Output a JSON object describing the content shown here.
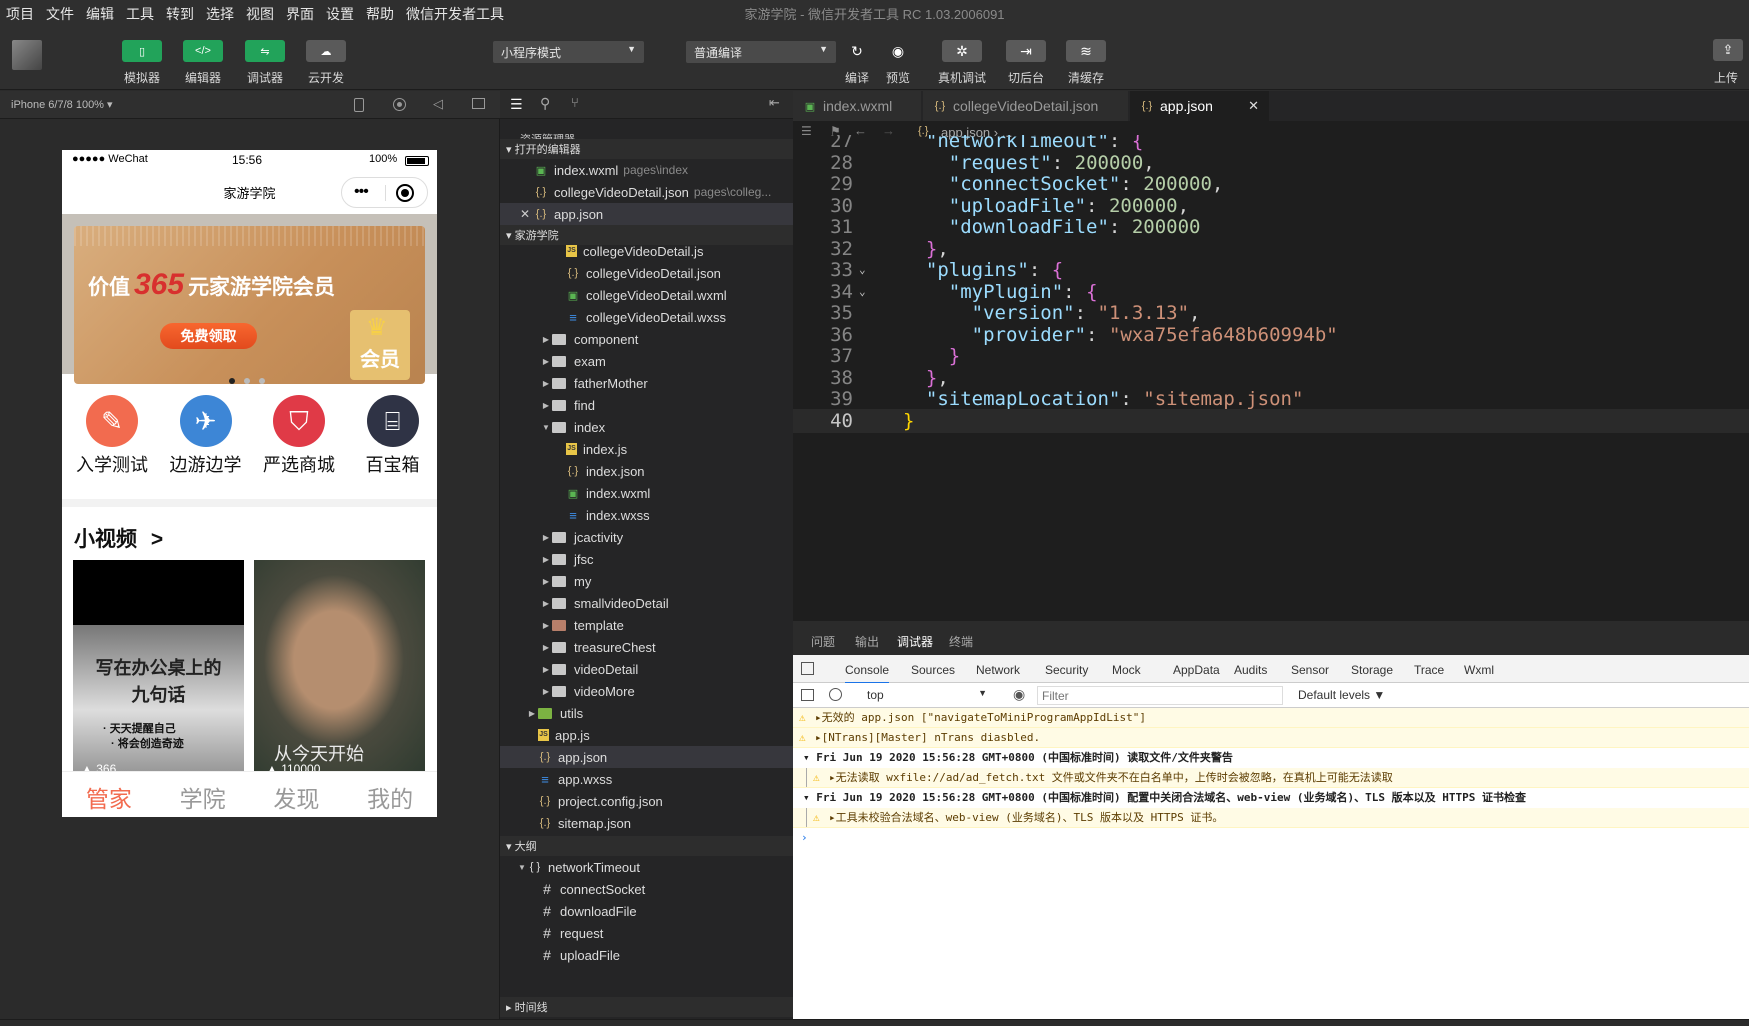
{
  "menubar": {
    "items": [
      "项目",
      "文件",
      "编辑",
      "工具",
      "转到",
      "选择",
      "视图",
      "界面",
      "设置",
      "帮助",
      "微信开发者工具"
    ],
    "window_title": "家游学院 - 微信开发者工具 RC 1.03.2006091"
  },
  "toolbar": {
    "left_buttons": [
      {
        "label": "模拟器",
        "icon": "phone-icon"
      },
      {
        "label": "编辑器",
        "icon": "code-icon"
      },
      {
        "label": "调试器",
        "icon": "debug-icon"
      },
      {
        "label": "云开发",
        "icon": "cloud-icon"
      }
    ],
    "mode_select": "小程序模式",
    "compile_select": "普通编译",
    "right_buttons": [
      {
        "label": "编译",
        "icon": "refresh-icon"
      },
      {
        "label": "预览",
        "icon": "eye-icon"
      },
      {
        "label": "真机调试",
        "icon": "bug-icon"
      },
      {
        "label": "切后台",
        "icon": "switch-icon"
      },
      {
        "label": "清缓存",
        "icon": "layers-icon"
      }
    ],
    "upload_label": "上传"
  },
  "simulator": {
    "device_label": "iPhone 6/7/8 100% ▾",
    "status": {
      "carrier": "●●●●● WeChat",
      "time": "15:56",
      "battery": "100%"
    },
    "nav_title": "家游学院",
    "banner": {
      "text_prefix": "价值",
      "number": "365",
      "text_suffix": "元家游学院会员",
      "button": "免费领取",
      "badge": "会员"
    },
    "categories": [
      {
        "label": "入学测试",
        "icon": "pencil-icon",
        "color": "#f26b4f"
      },
      {
        "label": "边游边学",
        "icon": "plane-icon",
        "color": "#3d86d6"
      },
      {
        "label": "严选商城",
        "icon": "bag-icon",
        "color": "#e03a47"
      },
      {
        "label": "百宝箱",
        "icon": "gift-icon",
        "color": "#2f3345"
      }
    ],
    "section_title": "小视频",
    "section_more": ">",
    "videos": [
      {
        "text1": "写在办公桌上的",
        "text2": "九句话",
        "sub1": "· 天天提醒自己",
        "sub2": "· 将会创造奇迹",
        "count": "366"
      },
      {
        "overlay": "从今天开始",
        "count": "110000"
      }
    ],
    "tabbar": [
      {
        "label": "管家",
        "active": true
      },
      {
        "label": "学院",
        "active": false
      },
      {
        "label": "发现",
        "active": false
      },
      {
        "label": "我的",
        "active": false
      }
    ]
  },
  "explorer": {
    "title": "资源管理器",
    "open_editors_header": "打开的编辑器",
    "open_editors": [
      {
        "name": "index.wxml",
        "path": "pages\\index",
        "type": "wxml"
      },
      {
        "name": "collegeVideoDetail.json",
        "path": "pages\\colleg...",
        "type": "json"
      },
      {
        "name": "app.json",
        "path": "",
        "type": "json",
        "closing": true
      }
    ],
    "project_header": "家游学院",
    "tree": [
      {
        "name": "collegeVideoDetail.js",
        "type": "js",
        "depth": 3
      },
      {
        "name": "collegeVideoDetail.json",
        "type": "json",
        "depth": 3
      },
      {
        "name": "collegeVideoDetail.wxml",
        "type": "wxml",
        "depth": 3
      },
      {
        "name": "collegeVideoDetail.wxss",
        "type": "wxss",
        "depth": 3
      },
      {
        "name": "component",
        "type": "folder",
        "depth": 2
      },
      {
        "name": "exam",
        "type": "folder",
        "depth": 2
      },
      {
        "name": "fatherMother",
        "type": "folder",
        "depth": 2
      },
      {
        "name": "find",
        "type": "folder",
        "depth": 2
      },
      {
        "name": "index",
        "type": "folder-open",
        "depth": 2
      },
      {
        "name": "index.js",
        "type": "js",
        "depth": 3
      },
      {
        "name": "index.json",
        "type": "json",
        "depth": 3
      },
      {
        "name": "index.wxml",
        "type": "wxml",
        "depth": 3
      },
      {
        "name": "index.wxss",
        "type": "wxss",
        "depth": 3
      },
      {
        "name": "jcactivity",
        "type": "folder",
        "depth": 2
      },
      {
        "name": "jfsc",
        "type": "folder",
        "depth": 2
      },
      {
        "name": "my",
        "type": "folder",
        "depth": 2
      },
      {
        "name": "smallvideoDetail",
        "type": "folder",
        "depth": 2
      },
      {
        "name": "template",
        "type": "folder-special",
        "depth": 2
      },
      {
        "name": "treasureChest",
        "type": "folder",
        "depth": 2
      },
      {
        "name": "videoDetail",
        "type": "folder",
        "depth": 2
      },
      {
        "name": "videoMore",
        "type": "folder",
        "depth": 2
      },
      {
        "name": "utils",
        "type": "folder-green",
        "depth": 1
      },
      {
        "name": "app.js",
        "type": "js",
        "depth": 1
      },
      {
        "name": "app.json",
        "type": "json",
        "depth": 1,
        "selected": true
      },
      {
        "name": "app.wxss",
        "type": "wxss",
        "depth": 1
      },
      {
        "name": "project.config.json",
        "type": "json",
        "depth": 1
      },
      {
        "name": "sitemap.json",
        "type": "json",
        "depth": 1
      }
    ],
    "outline_header": "大纲",
    "outline": [
      {
        "name": "networkTimeout",
        "type": "object",
        "depth": 1
      },
      {
        "name": "connectSocket",
        "type": "hash",
        "depth": 2
      },
      {
        "name": "downloadFile",
        "type": "hash",
        "depth": 2
      },
      {
        "name": "request",
        "type": "hash",
        "depth": 2
      },
      {
        "name": "uploadFile",
        "type": "hash",
        "depth": 2
      }
    ],
    "timeline_header": "时间线"
  },
  "editor": {
    "tabs": [
      {
        "name": "index.wxml",
        "type": "wxml"
      },
      {
        "name": "collegeVideoDetail.json",
        "type": "json"
      },
      {
        "name": "app.json",
        "type": "json",
        "active": true
      }
    ],
    "breadcrumb": "app.json › ...",
    "lines": [
      {
        "n": "27",
        "t": "  \"networkTimeout\": {"
      },
      {
        "n": "28",
        "t": "    \"request\": 200000,"
      },
      {
        "n": "29",
        "t": "    \"connectSocket\": 200000,"
      },
      {
        "n": "30",
        "t": "    \"uploadFile\": 200000,"
      },
      {
        "n": "31",
        "t": "    \"downloadFile\": 200000"
      },
      {
        "n": "32",
        "t": "  },"
      },
      {
        "n": "33",
        "t": "  \"plugins\": {"
      },
      {
        "n": "34",
        "t": "    \"myPlugin\": {"
      },
      {
        "n": "35",
        "t": "      \"version\": \"1.3.13\","
      },
      {
        "n": "36",
        "t": "      \"provider\": \"wxa75efa648b60994b\""
      },
      {
        "n": "37",
        "t": "    }"
      },
      {
        "n": "38",
        "t": "  },"
      },
      {
        "n": "39",
        "t": "  \"sitemapLocation\": \"sitemap.json\""
      },
      {
        "n": "40",
        "t": "}"
      }
    ]
  },
  "devtools": {
    "top_tabs": [
      "问题",
      "输出",
      "调试器",
      "终端"
    ],
    "active_top_tab": "调试器",
    "tabs": [
      "Console",
      "Sources",
      "Network",
      "Security",
      "Mock",
      "AppData",
      "Audits",
      "Sensor",
      "Storage",
      "Trace",
      "Wxml"
    ],
    "context": "top",
    "filter_placeholder": "Filter",
    "levels": "Default levels ▼",
    "console": [
      {
        "kind": "warn",
        "text": "▸无效的 app.json [\"navigateToMiniProgramAppIdList\"]"
      },
      {
        "kind": "warn",
        "text": "▸[NTrans][Master] nTrans diasbled."
      },
      {
        "kind": "group",
        "text": "▾ Fri Jun 19 2020 15:56:28 GMT+0800 (中国标准时间) 读取文件/文件夹警告"
      },
      {
        "kind": "warn-indent",
        "text": "▸无法读取 wxfile://ad/ad_fetch.txt 文件或文件夹不在白名单中，上传时会被忽略，在真机上可能无法读取"
      },
      {
        "kind": "group",
        "text": "▾ Fri Jun 19 2020 15:56:28 GMT+0800 (中国标准时间) 配置中关闭合法域名、web-view (业务域名)、TLS 版本以及 HTTPS 证书检查"
      },
      {
        "kind": "warn-indent",
        "text": "▸工具未校验合法域名、web-view (业务域名)、TLS 版本以及 HTTPS 证书。"
      },
      {
        "kind": "prompt",
        "text": "›"
      }
    ]
  },
  "colors": {
    "accent_green": "#22a35a",
    "banner_red": "#d8302e",
    "tab_active": "#f26b4f"
  }
}
